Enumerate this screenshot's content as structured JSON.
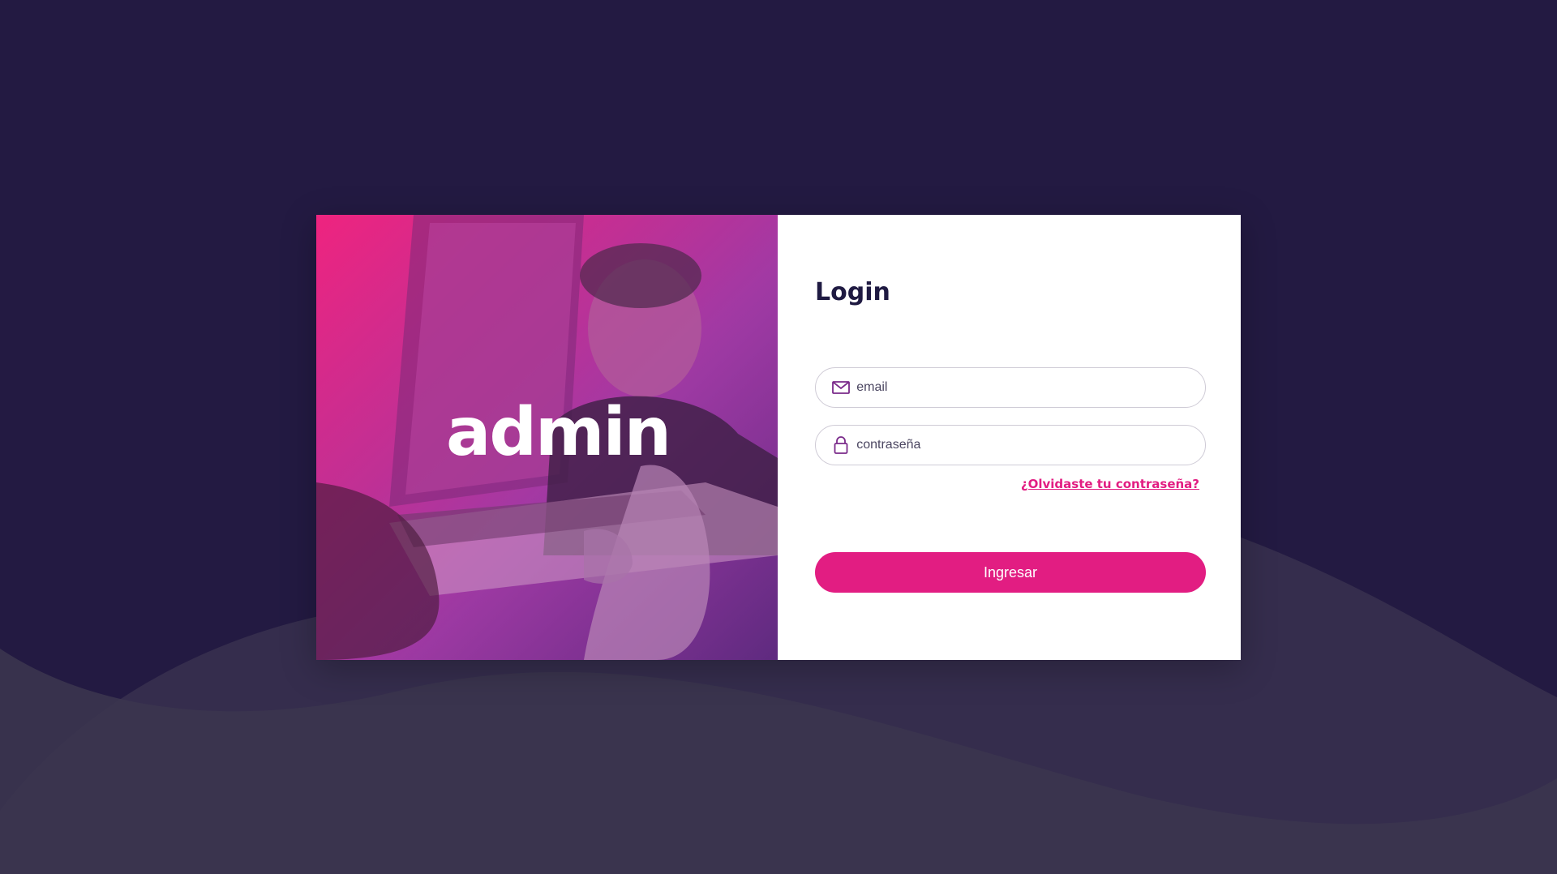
{
  "colors": {
    "background": "#231a42",
    "wave": "#3a3450",
    "accent": "#e21d82",
    "title": "#1f1a42"
  },
  "hero": {
    "logo_text": "admin"
  },
  "login": {
    "title": "Login",
    "email": {
      "placeholder": "email",
      "value": "",
      "icon": "envelope-icon"
    },
    "password": {
      "placeholder": "contraseña",
      "value": "",
      "icon": "lock-icon"
    },
    "forgot_link": "¿Olvidaste tu contraseña?",
    "submit_label": "Ingresar"
  }
}
